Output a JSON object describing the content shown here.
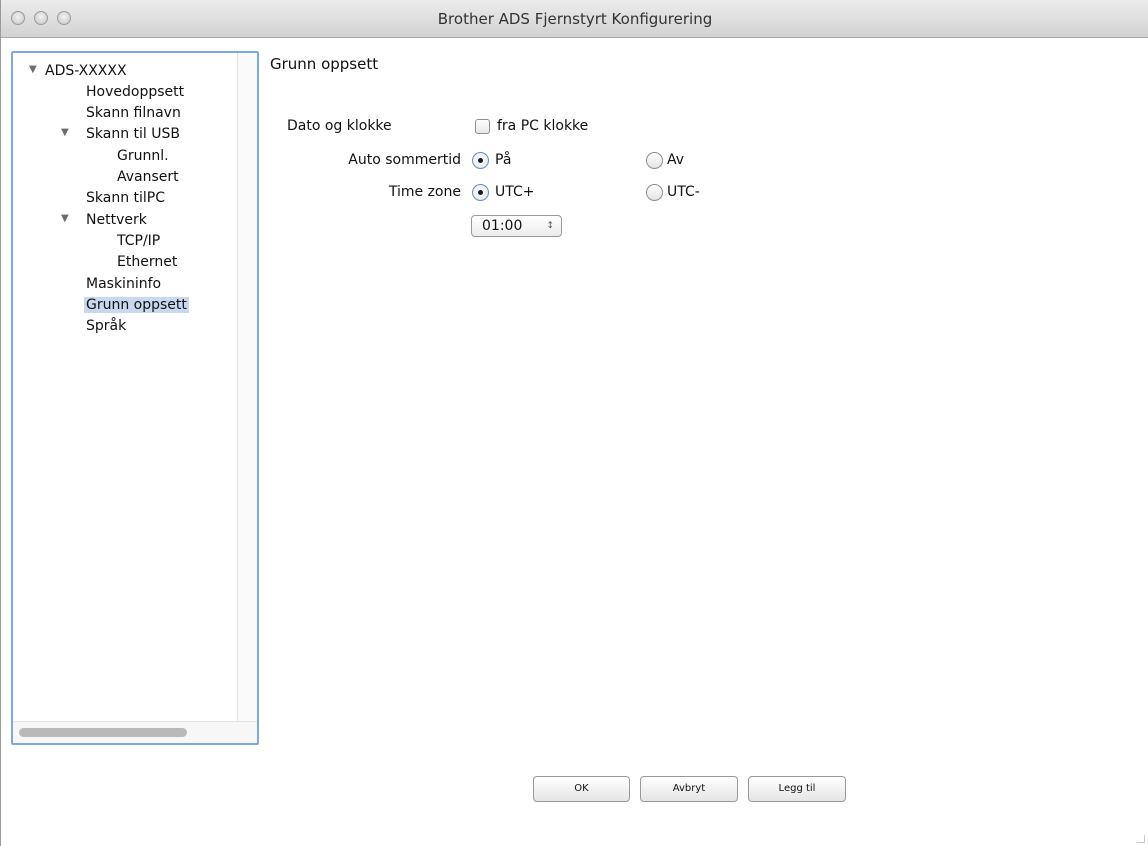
{
  "window": {
    "title": "Brother ADS Fjernstyrt Konfigurering"
  },
  "tree": {
    "items": [
      {
        "label": "ADS-XXXXX",
        "expander": "▼"
      },
      {
        "label": "Hovedoppsett"
      },
      {
        "label": "Skann filnavn"
      },
      {
        "label": "Skann til USB",
        "expander": "▼"
      },
      {
        "label": "Grunnl."
      },
      {
        "label": "Avansert"
      },
      {
        "label": "Skann tilPC"
      },
      {
        "label": "Nettverk",
        "expander": "▼"
      },
      {
        "label": "TCP/IP"
      },
      {
        "label": "Ethernet"
      },
      {
        "label": "Maskininfo"
      },
      {
        "label": "Grunn oppsett",
        "selected": true
      },
      {
        "label": "Språk"
      }
    ]
  },
  "main": {
    "title": "Grunn oppsett",
    "date_clock": {
      "label": "Dato og klokke",
      "checkbox_label": "fra PC klokke",
      "checked": false
    },
    "dst": {
      "label": "Auto sommertid",
      "options": [
        "På",
        "Av"
      ],
      "selected": "På"
    },
    "timezone": {
      "label": "Time zone",
      "options": [
        "UTC+",
        "UTC-"
      ],
      "selected": "UTC+",
      "value": "01:00"
    }
  },
  "buttons": {
    "ok": "OK",
    "cancel": "Avbryt",
    "add": "Legg til"
  },
  "colors": {
    "selection": "#c7d8ef",
    "focus_ring": "#7fa9dc"
  }
}
